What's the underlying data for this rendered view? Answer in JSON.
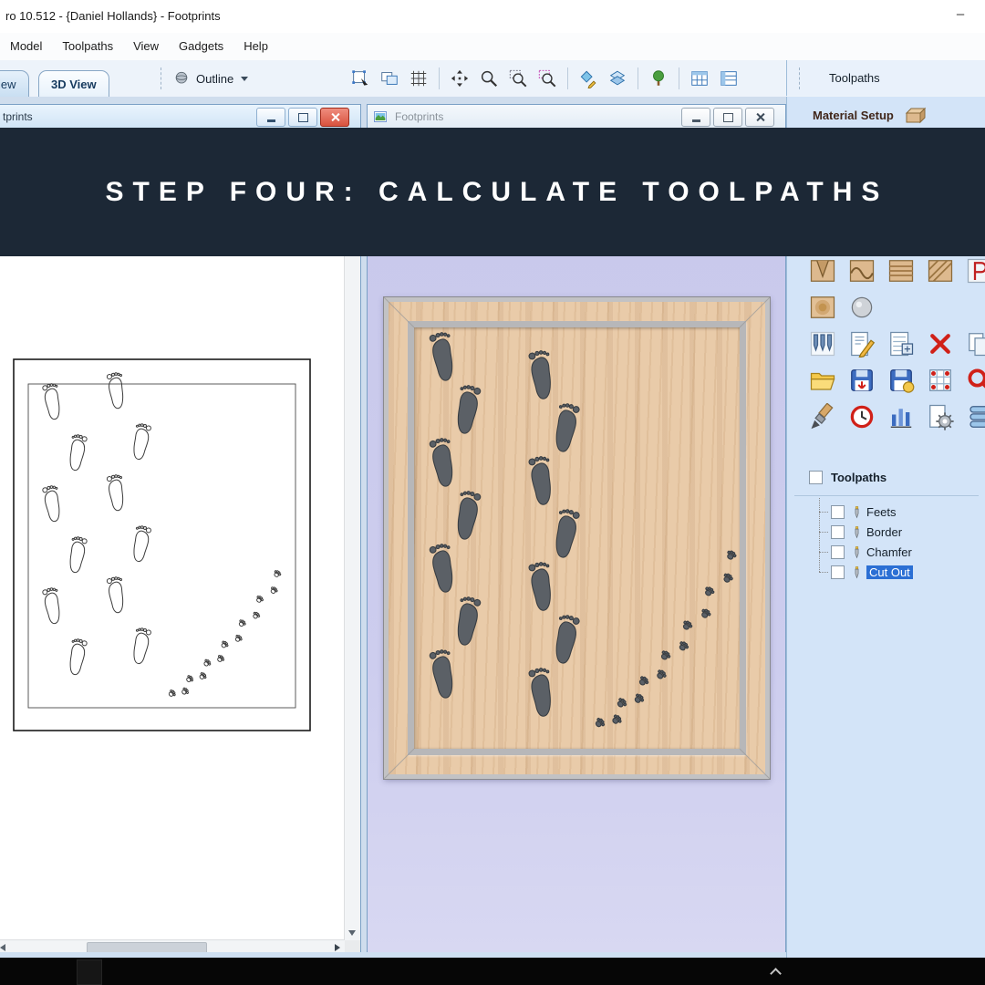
{
  "titlebar": {
    "title": "ro 10.512 - {Daniel Hollands} - Footprints"
  },
  "menubar": {
    "items": [
      "Model",
      "Toolpaths",
      "View",
      "Gadgets",
      "Help"
    ]
  },
  "view_tabs": {
    "tab_2d": "iew",
    "tab_3d": "3D View"
  },
  "toolbar": {
    "outline_label": "Outline",
    "icons": [
      "select-rectangle-icon",
      "transform-object-icon",
      "snap-grid-icon",
      "sep",
      "pan-view-icon",
      "zoom-icon",
      "zoom-window-icon",
      "zoom-selection-icon",
      "sep",
      "material-setup-diamond-icon",
      "layers-icon",
      "sep",
      "preview-tree-icon",
      "sep",
      "nesting-sheet-icon",
      "job-sheet-icon"
    ]
  },
  "panel": {
    "title": "Toolpaths",
    "material_setup_label": "Material Setup",
    "toolpath_ops_rows": [
      [
        "vcarve-toolpath-icon",
        "prism-toolpath-icon",
        "moulding-toolpath-icon",
        "texture-toolpath-icon",
        "profile-toolpath-icon"
      ],
      [
        "dome-toolpath-icon",
        "ball-toolpath-icon"
      ],
      [
        "drilling-toolpath-icon",
        "edit-toolpath-icon",
        "toolpath-summary-icon",
        "delete-toolpath-icon",
        "duplicate-toolpath-icon"
      ],
      [
        "open-toolpath-icon",
        "save-toolpath-icon",
        "save-all-toolpath-icon",
        "merge-toolpath-icon",
        "recalc-toolpath-icon"
      ],
      [
        "preview-brush-icon",
        "estimate-time-icon",
        "preview-bars-icon",
        "toolpath-template-icon",
        "tool-database-icon"
      ]
    ],
    "tree": {
      "header": "Toolpaths",
      "items": [
        {
          "label": "Feets",
          "checked": false,
          "selected": false
        },
        {
          "label": "Border",
          "checked": false,
          "selected": false
        },
        {
          "label": "Chamfer",
          "checked": false,
          "selected": false
        },
        {
          "label": "Cut Out",
          "checked": false,
          "selected": true
        }
      ]
    }
  },
  "banner": {
    "text": "STEP FOUR: CALCULATE TOOLPATHS"
  },
  "windows": {
    "left": {
      "title": "tprints"
    },
    "right": {
      "title": "Footprints"
    }
  }
}
